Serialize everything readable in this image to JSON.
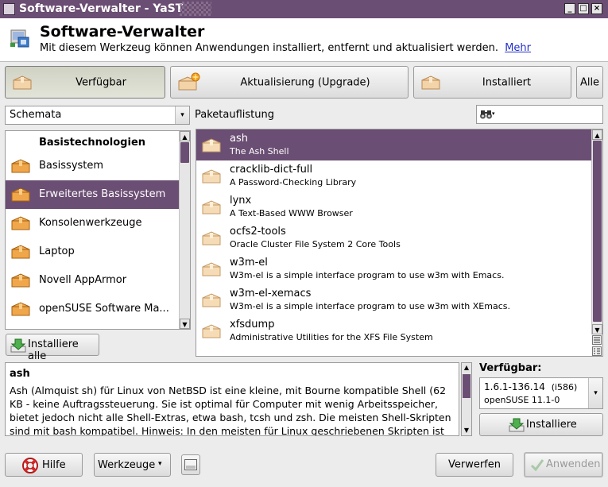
{
  "window": {
    "title": "Software-Verwalter - YaST",
    "minimize": "_",
    "maximize": "□",
    "close": "×"
  },
  "header": {
    "title": "Software-Verwalter",
    "subtitle": "Mit diesem Werkzeug können Anwendungen installiert, entfernt und aktualisiert werden.",
    "more_link": "Mehr"
  },
  "tabs": [
    {
      "label": "Verfügbar",
      "active": true
    },
    {
      "label": "Aktualisierung (Upgrade)",
      "active": false
    },
    {
      "label": "Installiert",
      "active": false
    },
    {
      "label": "Alle",
      "active": false
    }
  ],
  "filter": {
    "selected": "Schemata",
    "arrow": "▾"
  },
  "package_list_label": "Paketauflistung",
  "search": {
    "value": "",
    "arrow": "▾"
  },
  "categories": {
    "heading": "Basistechnologien",
    "items": [
      {
        "label": "Basissystem",
        "selected": false
      },
      {
        "label": "Erweitertes Basissystem",
        "selected": true
      },
      {
        "label": "Konsolenwerkzeuge",
        "selected": false
      },
      {
        "label": "Laptop",
        "selected": false
      },
      {
        "label": "Novell AppArmor",
        "selected": false
      },
      {
        "label": "openSUSE Software Ma...",
        "selected": false
      }
    ]
  },
  "install_all_label": "Installiere alle",
  "packages": [
    {
      "name": "ash",
      "desc": "The Ash Shell",
      "selected": true
    },
    {
      "name": "cracklib-dict-full",
      "desc": "A Password-Checking Library",
      "selected": false
    },
    {
      "name": "lynx",
      "desc": "A Text-Based WWW Browser",
      "selected": false
    },
    {
      "name": "ocfs2-tools",
      "desc": "Oracle Cluster File System 2 Core Tools",
      "selected": false
    },
    {
      "name": "w3m-el",
      "desc": "W3m-el is a simple interface program to use w3m with Emacs.",
      "selected": false
    },
    {
      "name": "w3m-el-xemacs",
      "desc": "W3m-el is a simple interface program to use w3m with XEmacs.",
      "selected": false
    },
    {
      "name": "xfsdump",
      "desc": "Administrative Utilities for the XFS File System",
      "selected": false
    }
  ],
  "details": {
    "name": "ash",
    "text": "Ash (Almquist sh) für Linux von NetBSD ist eine kleine, mit Bourne kompatible Shell (62 KB - keine Auftragssteuerung. Sie ist optimal für Computer mit wenig Arbeitsspeicher, bietet jedoch nicht alle Shell-Extras, etwa bash, tcsh und zsh. Die meisten Shell-Skripten sind mit bash kompatibel. Hinweis: In den meisten für Linux geschriebenen Skripten ist bash spezifische Syntax enthalten. Die Shell auf Einfühlsamkeit testen, ..."
  },
  "available": {
    "label": "Verfügbar:",
    "version": "1.6.1-136.14",
    "arch": "(i586)",
    "repo": "openSUSE 11.1-0",
    "arrow": "▾",
    "install_label": "Installiere"
  },
  "footer": {
    "help_label": "Hilfe",
    "tools_label": "Werkzeuge",
    "tools_arrow": "▾",
    "discard_label": "Verwerfen",
    "apply_label": "Anwenden"
  },
  "colors": {
    "accent": "#6b4e73",
    "link": "#2332c8"
  }
}
